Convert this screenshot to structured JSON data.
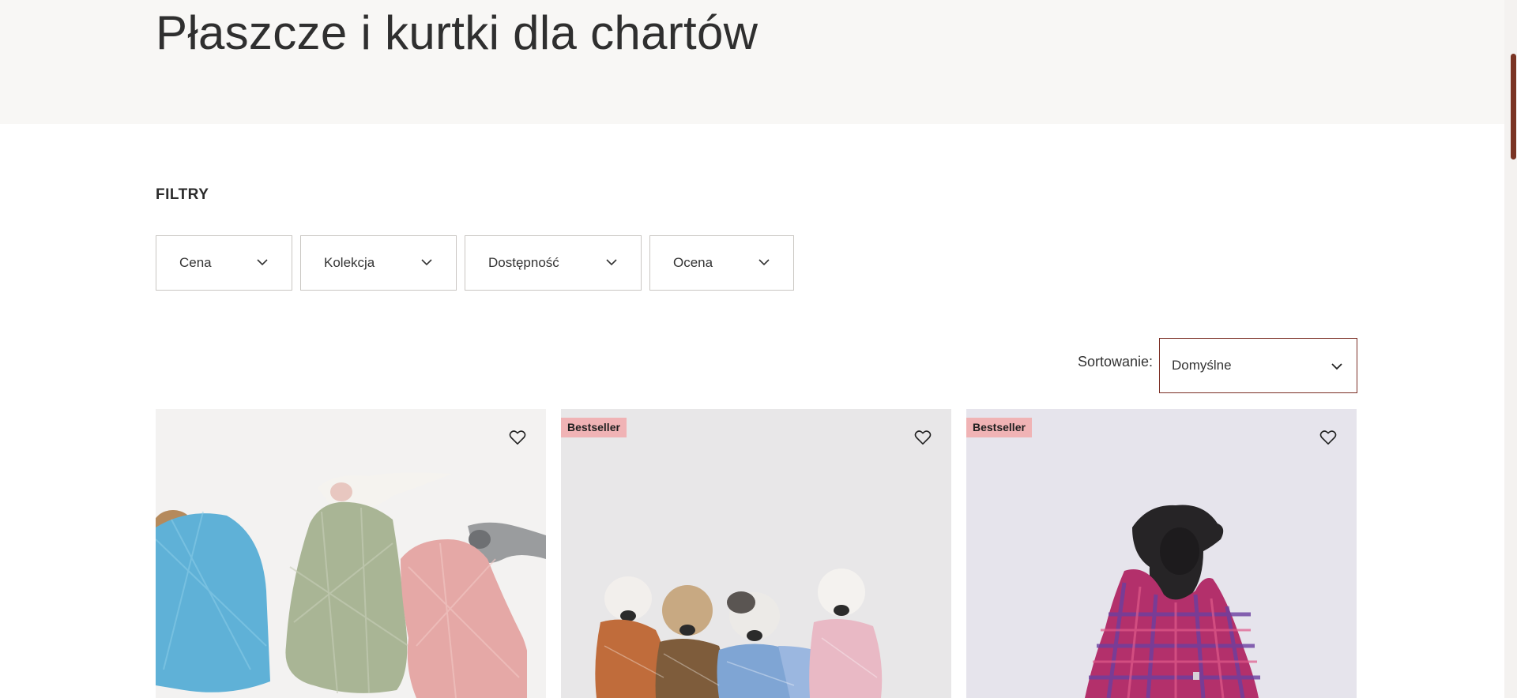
{
  "page": {
    "title": "Płaszcze i kurtki dla chartów"
  },
  "filters": {
    "heading": "FILTRY",
    "items": [
      {
        "label": "Cena"
      },
      {
        "label": "Kolekcja"
      },
      {
        "label": "Dostępność"
      },
      {
        "label": "Ocena"
      }
    ]
  },
  "sorting": {
    "label": "Sortowanie:",
    "selected": "Domyślne"
  },
  "products": [
    {
      "badge": "",
      "image": "three greyhounds in blue, green and pink plaid coats"
    },
    {
      "badge": "Bestseller",
      "image": "four greyhounds in patterned coats"
    },
    {
      "badge": "Bestseller",
      "image": "black greyhound in purple-red plaid coat"
    }
  ],
  "icons": {
    "filter_chevron": "chevron-down-icon",
    "wishlist": "heart-icon"
  },
  "colors": {
    "accent": "#7a2e24",
    "badge": "#f0b3b5",
    "hero_bg": "#f8f7f5"
  }
}
